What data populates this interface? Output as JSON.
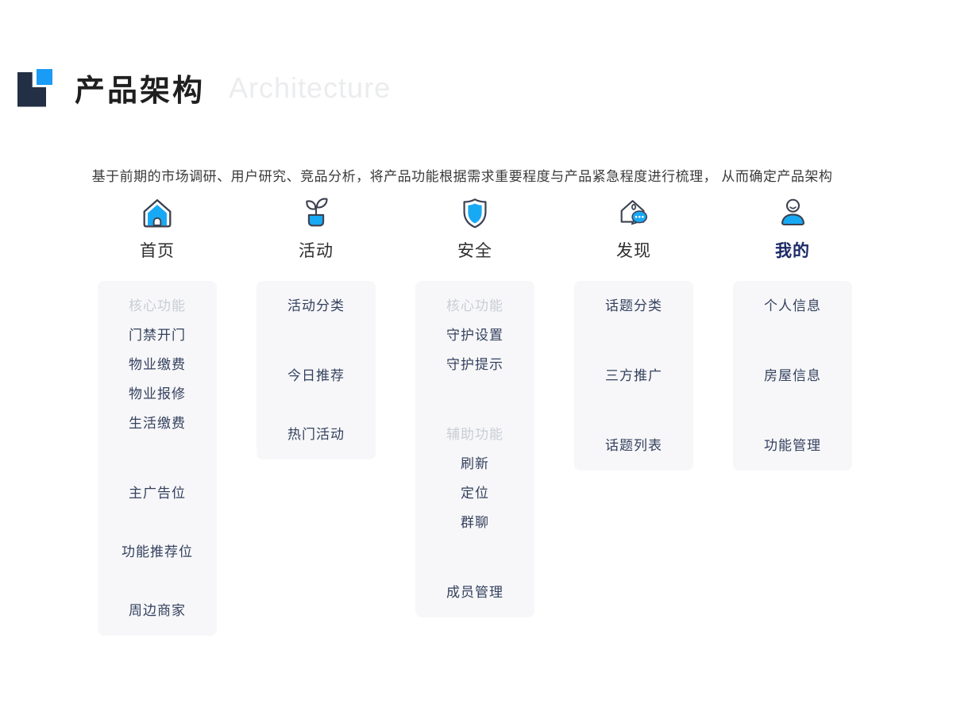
{
  "header": {
    "title": "产品架构",
    "subtitle": "Architecture"
  },
  "description": "基于前期的市场调研、用户研究、竞品分析，将产品功能根据需求重要程度与产品紧急程度进行梳理， 从而确定产品架构",
  "colors": {
    "accent_blue": "#18a9f5",
    "logo_navy": "#232f44",
    "logo_blue": "#1a9bf5",
    "card_background": "#f7f7f9",
    "item_text": "#34415e",
    "muted_group_text": "#c9cdd5",
    "highlight_label": "#1b2a66",
    "subtitle_gray": "#ebecee"
  },
  "columns": [
    {
      "key": "home",
      "label": "首页",
      "icon": "home-icon",
      "items": [
        {
          "text": "核心功能",
          "muted": true
        },
        {
          "text": "门禁开门"
        },
        {
          "text": "物业缴费"
        },
        {
          "text": "物业报修"
        },
        {
          "text": "生活缴费"
        },
        {
          "text": "主广告位",
          "gap": "lg"
        },
        {
          "text": "功能推荐位",
          "gap": "md"
        },
        {
          "text": "周边商家",
          "gap": "md"
        }
      ]
    },
    {
      "key": "activity",
      "label": "活动",
      "icon": "plant-icon",
      "items": [
        {
          "text": "活动分类"
        },
        {
          "text": "今日推荐",
          "gap": "lg"
        },
        {
          "text": "热门活动",
          "gap": "md"
        }
      ]
    },
    {
      "key": "security",
      "label": "安全",
      "icon": "shield-icon",
      "items": [
        {
          "text": "核心功能",
          "muted": true
        },
        {
          "text": "守护设置"
        },
        {
          "text": "守护提示"
        },
        {
          "text": "辅助功能",
          "muted": true,
          "gap": "lg"
        },
        {
          "text": "刷新"
        },
        {
          "text": "定位"
        },
        {
          "text": "群聊"
        },
        {
          "text": "成员管理",
          "gap": "lg"
        }
      ]
    },
    {
      "key": "discover",
      "label": "发现",
      "icon": "discover-icon",
      "items": [
        {
          "text": "话题分类"
        },
        {
          "text": "三方推广",
          "gap": "lg"
        },
        {
          "text": "话题列表",
          "gap": "lg"
        }
      ]
    },
    {
      "key": "mine",
      "label": "我的",
      "icon": "person-icon",
      "highlight": true,
      "items": [
        {
          "text": "个人信息"
        },
        {
          "text": "房屋信息",
          "gap": "lg"
        },
        {
          "text": "功能管理",
          "gap": "lg"
        }
      ]
    }
  ]
}
